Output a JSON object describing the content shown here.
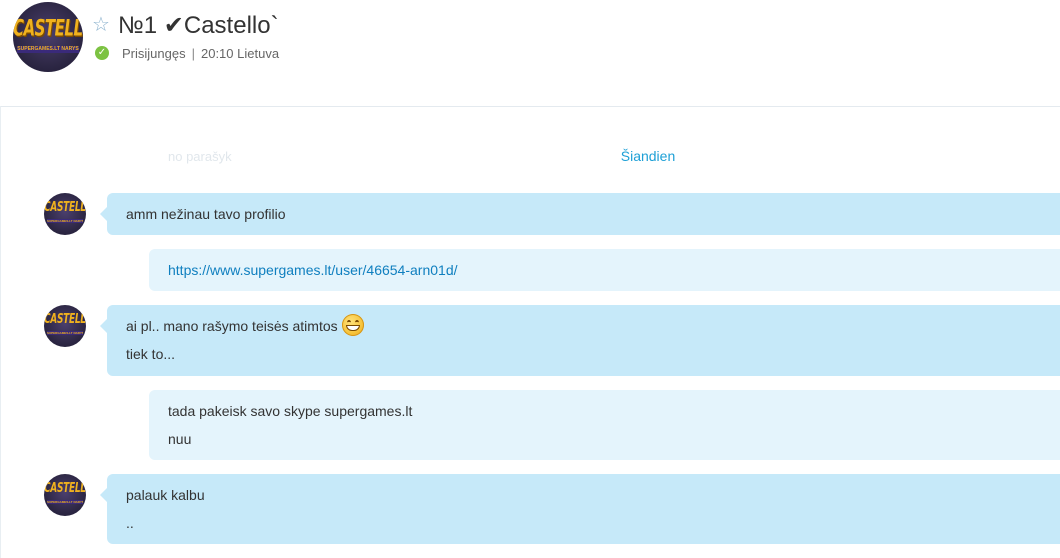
{
  "header": {
    "avatar_logo": "CASTELLO",
    "avatar_logo_sub": "SUPERGAMES.LT NARYS",
    "star_icon": "star-outline-icon",
    "contact_name": "№1 ✔Castello`",
    "status_icon": "online-check-icon",
    "status_text": "Prisijungęs",
    "separator": "|",
    "local_time": "20:10 Lietuva",
    "colors": {
      "status_online": "#7cc242",
      "accent": "#1ea0d6"
    }
  },
  "conversation": {
    "ghost_text": "no parašyk",
    "date_label": "Šiandien",
    "messages": [
      {
        "direction": "in",
        "lines": [
          "amm nežinau tavo profilio"
        ]
      },
      {
        "direction": "out",
        "lines": [
          "https://www.supergames.lt/user/46654-arn01d/"
        ]
      },
      {
        "direction": "in",
        "lines": [
          "ai pl.. mano rašymo teisės atimtos",
          "tiek to..."
        ],
        "emoji": "grinning-face-icon"
      },
      {
        "direction": "out",
        "lines": [
          "tada pakeisk savo skype supergames.lt",
          "nuu"
        ]
      },
      {
        "direction": "in",
        "lines": [
          "palauk kalbu",
          ".."
        ]
      }
    ],
    "colors": {
      "incoming_bubble": "#c6e9f9",
      "outgoing_bubble": "#e4f4fc",
      "link": "#0f7fbf"
    }
  }
}
